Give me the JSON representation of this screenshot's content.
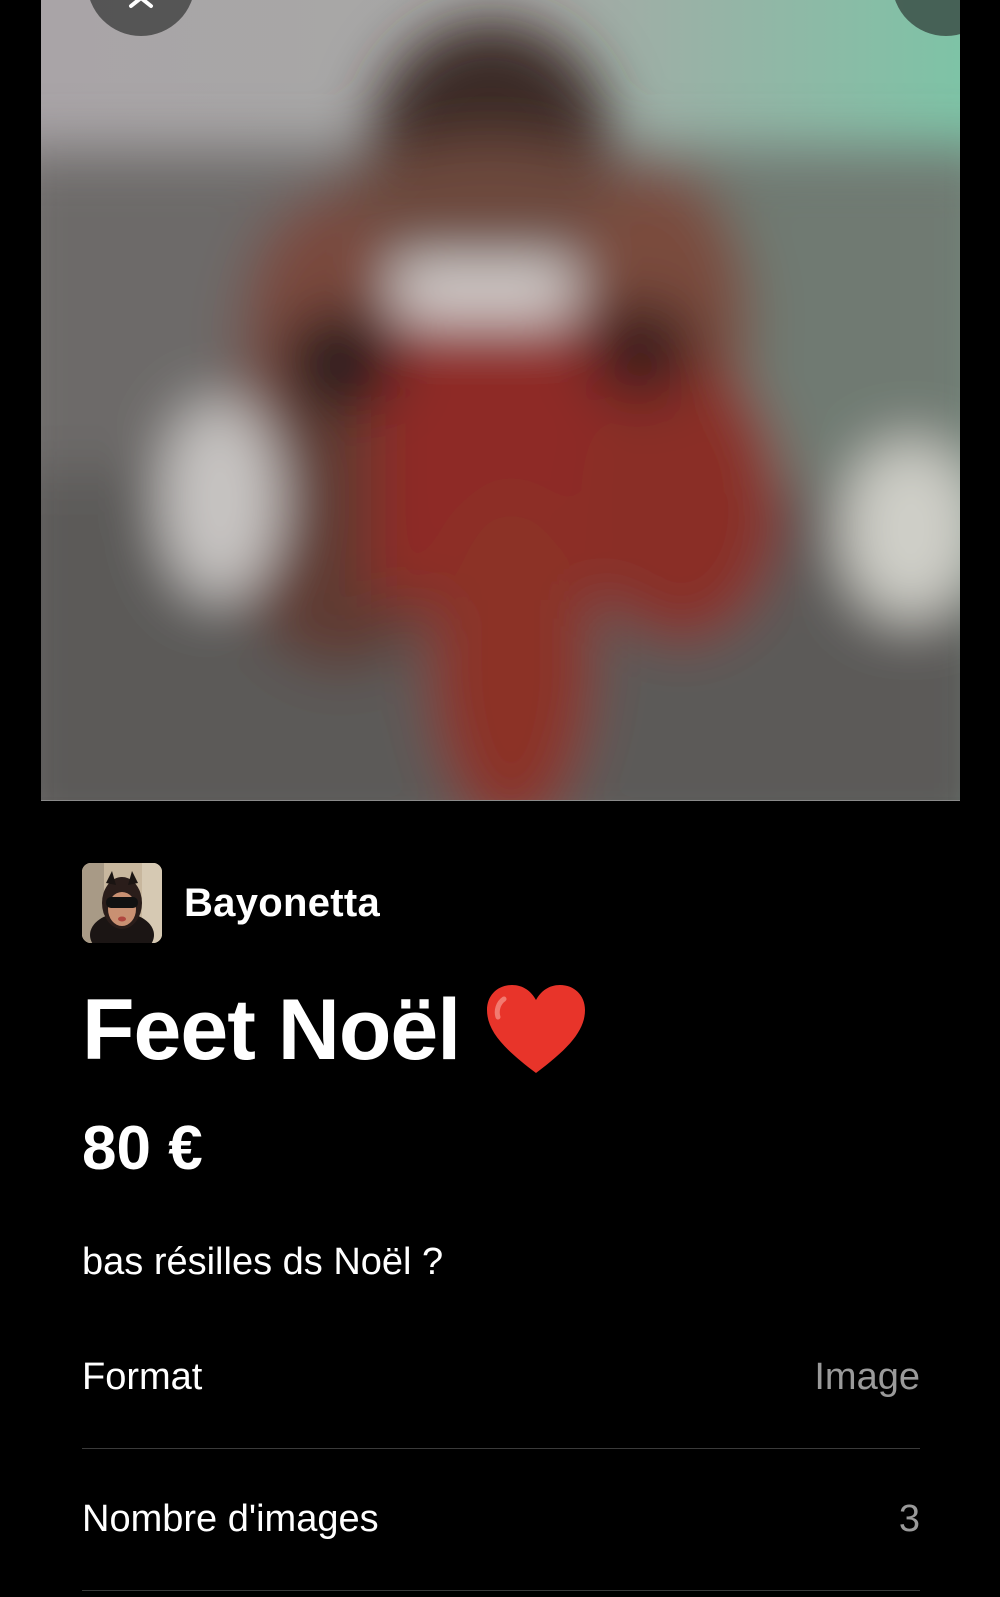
{
  "media": {
    "image_icon": "blurred-preview-image",
    "prev_icon": "chevron-left-icon",
    "next_icon": "chevron-right-icon"
  },
  "creator": {
    "name": "Bayonetta",
    "avatar_icon": "avatar"
  },
  "post": {
    "title": "Feet Noël",
    "title_emoji": "red-heart-icon",
    "price": "80 €",
    "description": "bas résilles ds Noël ?"
  },
  "details": [
    {
      "label": "Format",
      "value": "Image"
    },
    {
      "label": "Nombre d'images",
      "value": "3"
    }
  ],
  "colors": {
    "background": "#000000",
    "text_primary": "#ffffff",
    "text_secondary": "#9a9a9a",
    "divider": "#3a3a3a",
    "heart": "#e8342a"
  }
}
